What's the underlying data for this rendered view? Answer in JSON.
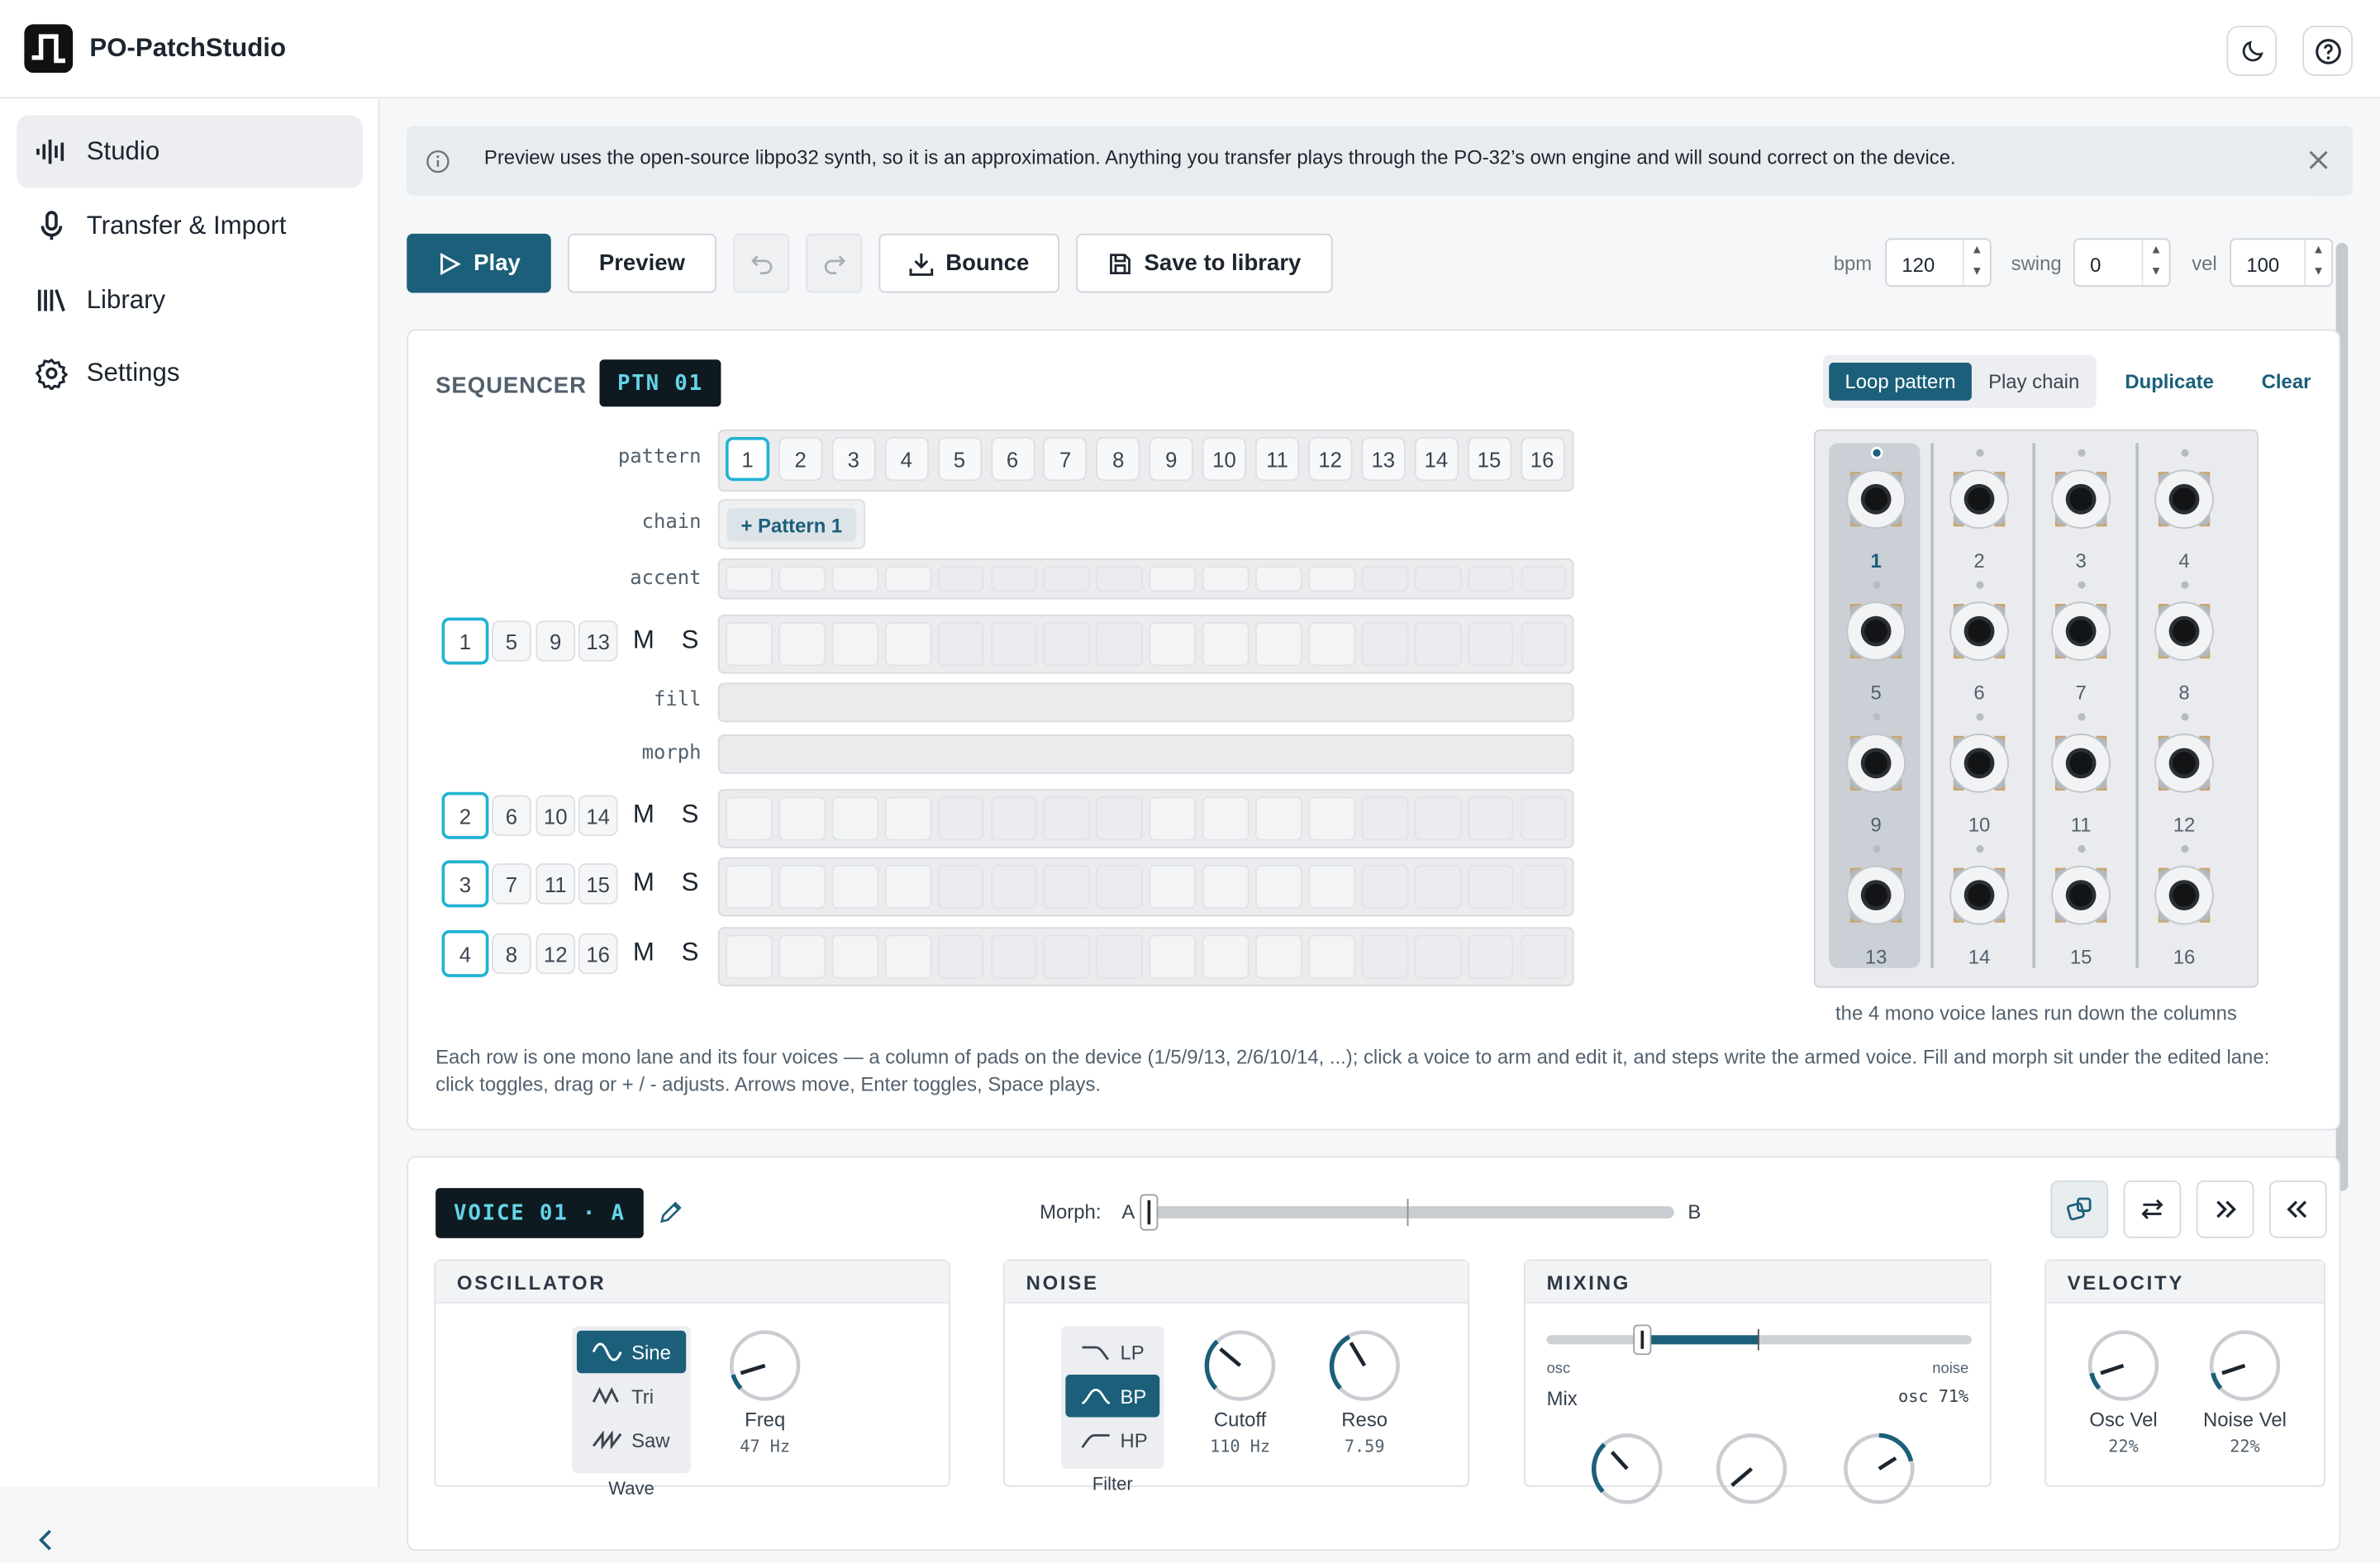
{
  "app": {
    "title": "PO-PatchStudio"
  },
  "nav": [
    {
      "label": "Studio",
      "icon": "waveform-icon",
      "active": true
    },
    {
      "label": "Transfer & Import",
      "icon": "microphone-icon"
    },
    {
      "label": "Library",
      "icon": "library-icon"
    },
    {
      "label": "Settings",
      "icon": "gear-icon"
    }
  ],
  "banner": {
    "text": "Preview uses the open-source libpo32 synth, so it is an approximation. Anything you transfer plays through the PO-32’s own engine and will sound correct on the device."
  },
  "toolbar": {
    "play": "Play",
    "preview": "Preview",
    "bounce": "Bounce",
    "save": "Save to library"
  },
  "transport": {
    "bpm_label": "bpm",
    "bpm": "120",
    "swing_label": "swing",
    "swing": "0",
    "vel_label": "vel",
    "vel": "100"
  },
  "sequencer": {
    "title": "SEQUENCER",
    "pattern_badge": "PTN 01",
    "loop_pattern": "Loop pattern",
    "play_chain": "Play chain",
    "duplicate": "Duplicate",
    "clear": "Clear",
    "row_labels": {
      "pattern": "pattern",
      "chain": "chain",
      "accent": "accent",
      "fill": "fill",
      "morph": "morph"
    },
    "patterns": [
      "1",
      "2",
      "3",
      "4",
      "5",
      "6",
      "7",
      "8",
      "9",
      "10",
      "11",
      "12",
      "13",
      "14",
      "15",
      "16"
    ],
    "selected_pattern": "1",
    "chain_button": "+ Pattern 1",
    "lanes": [
      {
        "voices": [
          "1",
          "5",
          "9",
          "13"
        ],
        "m": "M",
        "s": "S"
      },
      {
        "voices": [
          "2",
          "6",
          "10",
          "14"
        ],
        "m": "M",
        "s": "S"
      },
      {
        "voices": [
          "3",
          "7",
          "11",
          "15"
        ],
        "m": "M",
        "s": "S"
      },
      {
        "voices": [
          "4",
          "8",
          "12",
          "16"
        ],
        "m": "M",
        "s": "S"
      }
    ],
    "pads": [
      "1",
      "2",
      "3",
      "4",
      "5",
      "6",
      "7",
      "8",
      "9",
      "10",
      "11",
      "12",
      "13",
      "14",
      "15",
      "16"
    ],
    "pad_caption": "the 4 mono voice lanes run down the columns",
    "help": "Each row is one mono lane and its four voices — a column of pads on the device (1/5/9/13, 2/6/10/14, ...); click a voice to arm and edit it, and steps write the armed voice. Fill and morph sit under the edited lane: click toggles, drag or + / - adjusts. Arrows move, Enter toggles, Space plays."
  },
  "voice": {
    "badge": "VOICE 01 · A",
    "morph_label": "Morph:",
    "morph_a": "A",
    "morph_b": "B",
    "morph_value": 0.0
  },
  "oscillator": {
    "title": "OSCILLATOR",
    "waves": [
      "Sine",
      "Tri",
      "Saw"
    ],
    "selected": "Sine",
    "wave_label": "Wave",
    "freq_label": "Freq",
    "freq_value": "47 Hz"
  },
  "noise": {
    "title": "NOISE",
    "filters": [
      "LP",
      "BP",
      "HP"
    ],
    "selected": "BP",
    "filter_label": "Filter",
    "cutoff_label": "Cutoff",
    "cutoff_value": "110 Hz",
    "reso_label": "Reso",
    "reso_value": "7.59"
  },
  "mixing": {
    "title": "MIXING",
    "osc_label": "osc",
    "noise_label": "noise",
    "mix_label": "Mix",
    "mix_value": "osc 71%",
    "mix_level": 0.71
  },
  "velocity": {
    "title": "VELOCITY",
    "osc_vel_label": "Osc Vel",
    "osc_vel_value": "22%",
    "noise_vel_label": "Noise Vel",
    "noise_vel_value": "22%"
  },
  "colors": {
    "accent": "#1b5f7a",
    "armed": "#21b3d2",
    "lcd_bg": "#0e1a20",
    "lcd_fg": "#64d4e8"
  }
}
